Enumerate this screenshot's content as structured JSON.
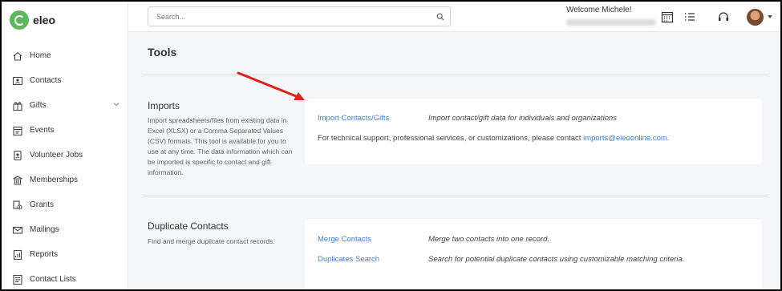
{
  "app": {
    "logo_text": "eleo"
  },
  "sidebar": {
    "items": [
      {
        "label": "Home",
        "icon": "home-icon"
      },
      {
        "label": "Contacts",
        "icon": "contacts-icon"
      },
      {
        "label": "Gifts",
        "icon": "gift-icon",
        "expandable": true
      },
      {
        "label": "Events",
        "icon": "calendar-icon"
      },
      {
        "label": "Volunteer Jobs",
        "icon": "badge-icon"
      },
      {
        "label": "Memberships",
        "icon": "building-icon"
      },
      {
        "label": "Grants",
        "icon": "grant-icon"
      },
      {
        "label": "Mailings",
        "icon": "mail-icon"
      },
      {
        "label": "Reports",
        "icon": "report-icon"
      },
      {
        "label": "Contact Lists",
        "icon": "list-icon"
      }
    ]
  },
  "header": {
    "search_placeholder": "Search...",
    "welcome": "Welcome Michele!",
    "icons": [
      "calendar-icon",
      "task-list-icon",
      "headset-icon",
      "avatar"
    ]
  },
  "main": {
    "title": "Tools",
    "imports": {
      "title": "Imports",
      "description": "Import spreadsheets/files from existing data in Excel (XLSX) or a Comma Separated Values (CSV) formats. This tool is available for you to use at any time. The data information which can be imported is specific to contact and gift information.",
      "link": "Import Contacts/Gifts",
      "link_desc": "Import contact/gift data for individuals and organizations",
      "support_text": "For technical support, professional services, or customizations, please contact ",
      "support_email": "imports@eleoonline.com",
      "support_end": "."
    },
    "duplicates": {
      "title": "Duplicate Contacts",
      "description": "Find and merge duplicate contact records.",
      "merge_link": "Merge Contacts",
      "merge_desc": "Merge two contacts into one record.",
      "search_link": "Duplicates Search",
      "search_desc": "Search for potential duplicate contacts using customizable matching criteria."
    }
  },
  "colors": {
    "accent": "#3f7fcf",
    "logo": "#5cb85c",
    "annotation_arrow": "#e0201b"
  }
}
